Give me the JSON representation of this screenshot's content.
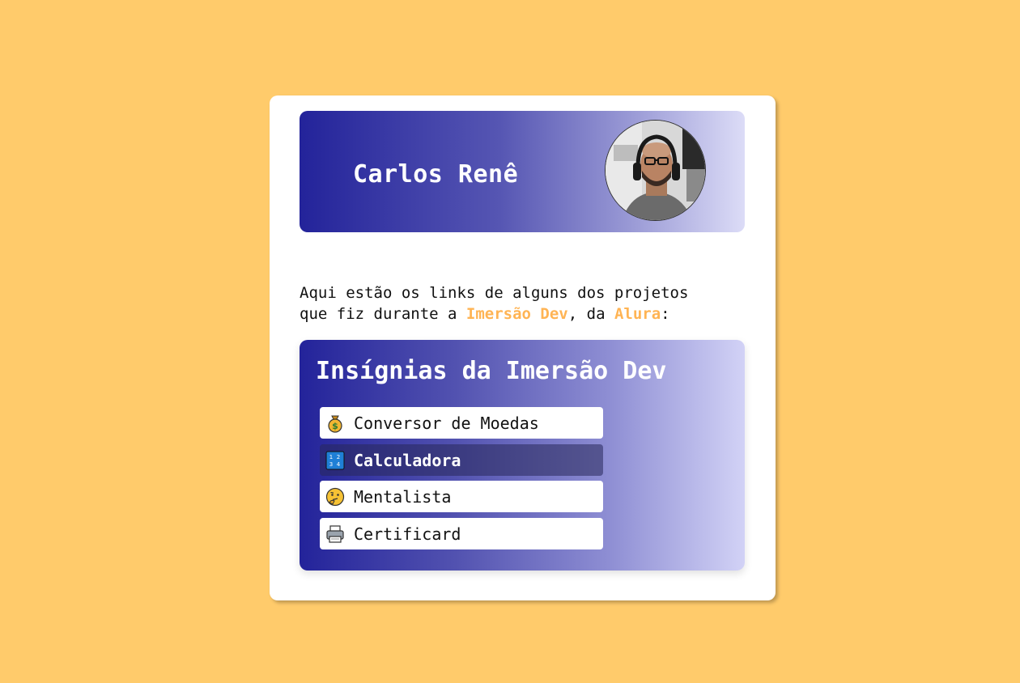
{
  "profile": {
    "name": "Carlos Renê",
    "avatar_icon": "profile-photo"
  },
  "intro": {
    "line1": "Aqui estão os links de alguns dos projetos",
    "line2_a": "que fiz durante a ",
    "highlight1": "Imersão Dev",
    "line2_b": ", da ",
    "highlight2": "Alura",
    "line2_c": ":"
  },
  "badges": {
    "title": "Insígnias da Imersão Dev",
    "items": [
      {
        "label": "Conversor de Moedas",
        "icon": "money-bag-icon",
        "active": false
      },
      {
        "label": "Calculadora",
        "icon": "numbers-icon",
        "active": true
      },
      {
        "label": "Mentalista",
        "icon": "thinking-face-icon",
        "active": false
      },
      {
        "label": "Certificard",
        "icon": "card-printer-icon",
        "active": false
      }
    ]
  },
  "colors": {
    "background": "#ffcb6b",
    "accent": "#ffb454",
    "gradient_start": "#23239a",
    "gradient_end": "#d2d2f6"
  }
}
